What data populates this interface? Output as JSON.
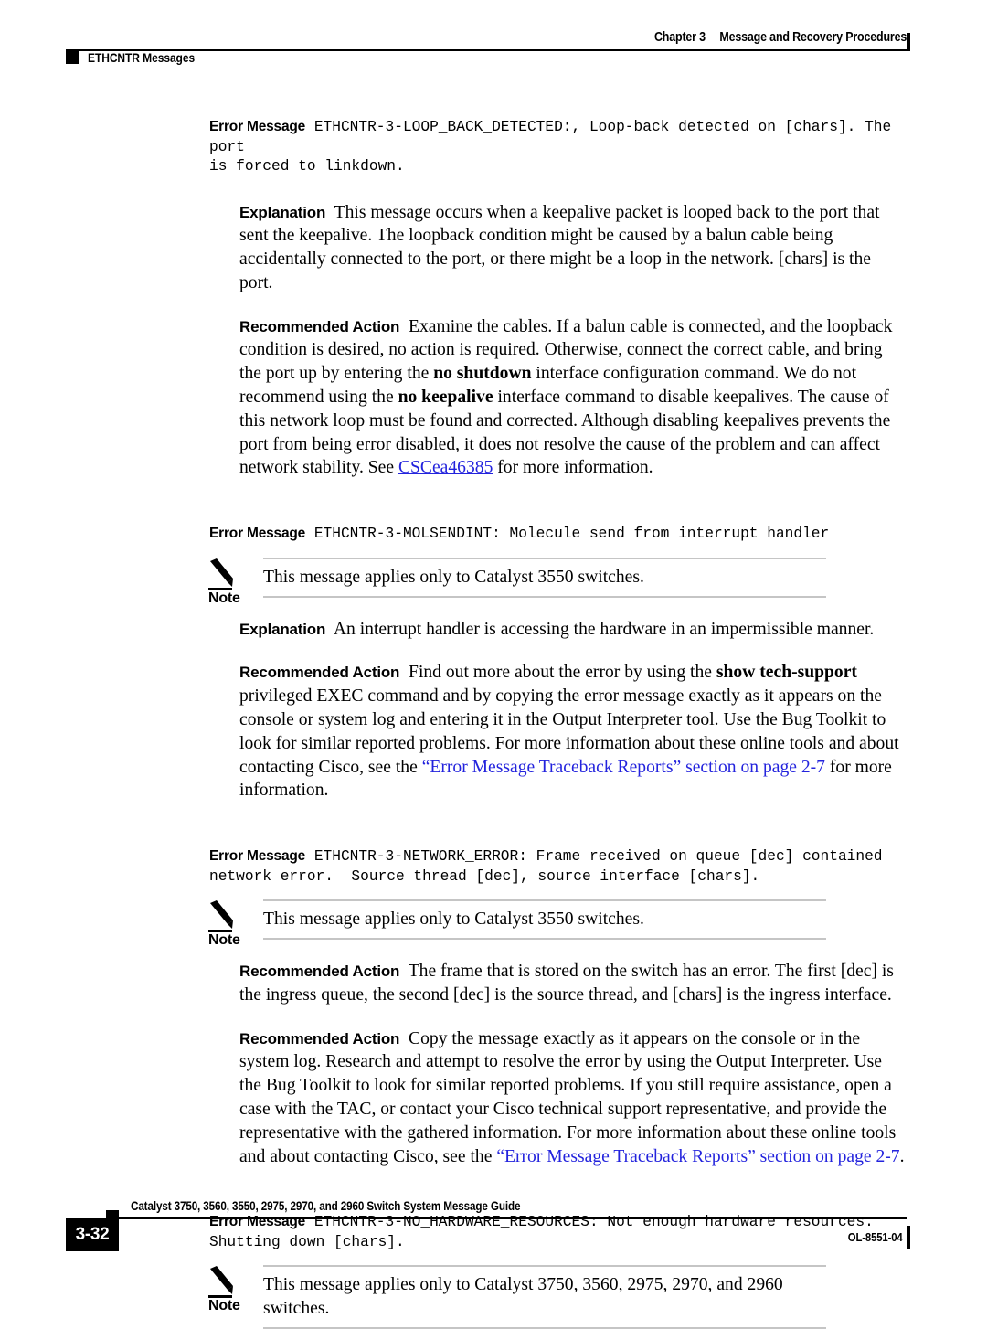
{
  "header": {
    "chapter": "Chapter 3",
    "chapter_title": "Message and Recovery Procedures",
    "section_label": "ETHCNTR Messages"
  },
  "footer": {
    "guide_title": "Catalyst 3750, 3560, 3550, 2975, 2970, and 2960 Switch System Message Guide",
    "page_number": "3-32",
    "doc_id": "OL-8551-04"
  },
  "colors": {
    "link_blue": "#2323dd",
    "rule_gray": "#c5c5c5",
    "ink": "#000000"
  },
  "labels": {
    "error_message": "Error Message",
    "explanation": "Explanation",
    "recommended_action": "Recommended Action",
    "note": "Note"
  },
  "messages": [
    {
      "id": "loop-back-detected",
      "error_message_code": "ETHCNTR-3-LOOP_BACK_DETECTED:, Loop-back detected on [chars]. The port\nis forced to linkdown.",
      "explanation": "This message occurs when a keepalive packet is looped back to the port that sent the keepalive. The loopback condition might be caused by a balun cable being accidentally connected to the port, or there might be a loop in the network. [chars] is the port.",
      "recommended_action_parts": {
        "p1": "Examine the cables. If a balun cable is connected, and the loopback condition is desired, no action is required. Otherwise, connect the correct cable, and bring the port up by entering the ",
        "cmd1": "no shutdown",
        "p2": " interface configuration command. We do not recommend using the ",
        "cmd2": "no keepalive",
        "p3": " interface command to disable keepalives. The cause of this network loop must be found and corrected. Although disabling keepalives prevents the port from being error disabled, it does not resolve the cause of the problem and can affect network stability. See ",
        "link": "CSCea46385",
        "p4": " for more information."
      }
    },
    {
      "id": "molsendint",
      "error_message_code": "ETHCNTR-3-MOLSENDINT: Molecule send from interrupt handler",
      "note": "This message applies only to Catalyst 3550 switches.",
      "explanation": "An interrupt handler is accessing the hardware in an impermissible manner.",
      "recommended_action_parts": {
        "p1": "Find out more about the error by using the ",
        "cmd1": "show tech-support",
        "p2": " privileged EXEC command and by copying the error message exactly as it appears on the console or system log and entering it in the Output Interpreter tool. Use the Bug Toolkit to look for similar reported problems. For more information about these online tools and about contacting Cisco, see the ",
        "xref": "“Error Message Traceback Reports” section on page 2-7",
        "p3": " for more information."
      }
    },
    {
      "id": "network-error",
      "error_message_code": "ETHCNTR-3-NETWORK_ERROR: Frame received on queue [dec] contained\nnetwork error.  Source thread [dec], source interface [chars].",
      "note": "This message applies only to Catalyst 3550 switches.",
      "recommended_action_1": "The frame that is stored on the switch has an error. The first [dec] is the ingress queue, the second [dec] is the source thread, and [chars] is the ingress interface.",
      "recommended_action_2_parts": {
        "p1": "Copy the message exactly as it appears on the console or in the system log. Research and attempt to resolve the error by using the Output Interpreter. Use the Bug Toolkit to look for similar reported problems. If you still require assistance, open a case with the TAC, or contact your Cisco technical support representative, and provide the representative with the gathered information. For more information about these online tools and about contacting Cisco, see the ",
        "xref": "“Error Message Traceback Reports” section on page 2-7",
        "p2": "."
      }
    },
    {
      "id": "no-hardware-resources",
      "error_message_code": "ETHCNTR-3-NO_HARDWARE_RESOURCES: Not enough hardware resources.\nShutting down [chars].",
      "note": "This message applies only to Catalyst 3750, 3560, 2975, 2970, and 2960 switches."
    }
  ]
}
